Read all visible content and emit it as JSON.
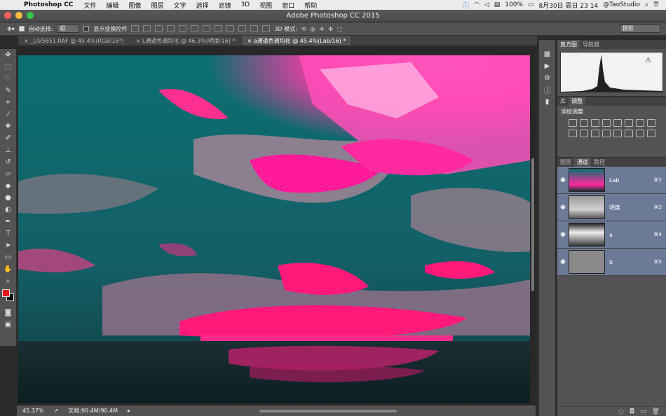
{
  "menubar": {
    "app": "Photoshop CC",
    "items": [
      "文件",
      "编辑",
      "图像",
      "图层",
      "文字",
      "选择",
      "滤镜",
      "3D",
      "视图",
      "窗口",
      "帮助"
    ],
    "battery": "100%",
    "datetime": "8月30日 周日  23 14",
    "user": "@TaoStudio"
  },
  "window": {
    "title": "Adobe Photoshop CC 2015"
  },
  "options": {
    "auto_select_label": "自动选择:",
    "auto_select_value": "组",
    "show_transform_label": "显示变换控件",
    "mode_3d_label": "3D 模式:",
    "workspace_value": "摄影"
  },
  "tabs": [
    {
      "label": "_LIV5651.RAF @ 45.4%(RGB/16*)"
    },
    {
      "label": "L通道色调均化 @ 46.3%(明度/16) *"
    },
    {
      "label": "a通道色调均化 @ 45.4%(Lab/16) *"
    }
  ],
  "status": {
    "zoom": "45.37%",
    "doc": "文档:90.4M/90.4M"
  },
  "histogram": {
    "tab1": "直方图",
    "tab2": "导航器"
  },
  "adjustments": {
    "tab1": "库",
    "tab2": "调整",
    "title": "添加调整"
  },
  "channels": {
    "tab_layers": "图层",
    "tab_channels": "通道",
    "tab_paths": "路径",
    "rows": [
      {
        "name": "Lab",
        "shortcut": "⌘2"
      },
      {
        "name": "明度",
        "shortcut": "⌘3"
      },
      {
        "name": "a",
        "shortcut": "⌘4"
      },
      {
        "name": "b",
        "shortcut": "⌘5"
      }
    ]
  },
  "colors": {
    "foreground": "#e8151e",
    "background": "#000000",
    "accent_pink": "#ff1a7a",
    "teal": "#0e7a78"
  }
}
